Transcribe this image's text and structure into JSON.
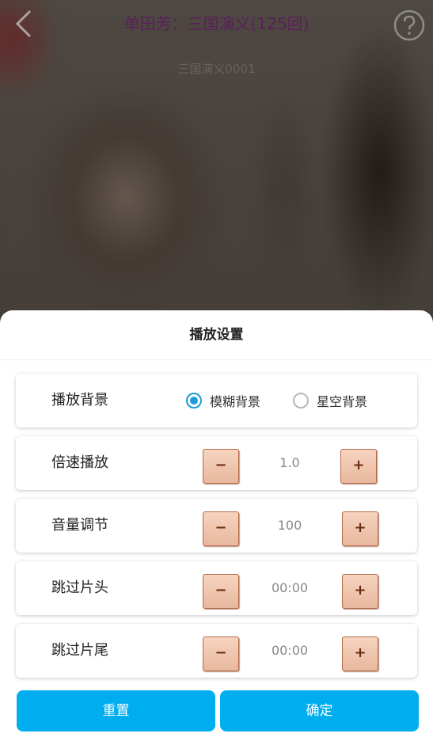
{
  "header": {
    "title": "单田芳：三国演义(125回)",
    "subtitle": "三国演义0001",
    "back_icon": "chevron-left-icon",
    "help_icon": "question-circle-icon"
  },
  "sheet": {
    "title": "播放设置",
    "background_row": {
      "label": "播放背景",
      "options": [
        {
          "label": "模糊背景",
          "selected": true
        },
        {
          "label": "星空背景",
          "selected": false
        }
      ]
    },
    "speed_row": {
      "label": "倍速播放",
      "minus": "−",
      "value": "1.0",
      "plus": "+"
    },
    "volume_row": {
      "label": "音量调节",
      "minus": "−",
      "value": "100",
      "plus": "+"
    },
    "skip_head_row": {
      "label": "跳过片头",
      "minus": "−",
      "value": "00:00",
      "plus": "+"
    },
    "skip_tail_row": {
      "label": "跳过片尾",
      "minus": "−",
      "value": "00:00",
      "plus": "+"
    },
    "reset_label": "重置",
    "confirm_label": "确定"
  },
  "colors": {
    "accent": "#00aeef",
    "radio_selected": "#1e9bd7",
    "title_color": "#5a1f5c",
    "stepper_fill": "#e8b79e"
  }
}
